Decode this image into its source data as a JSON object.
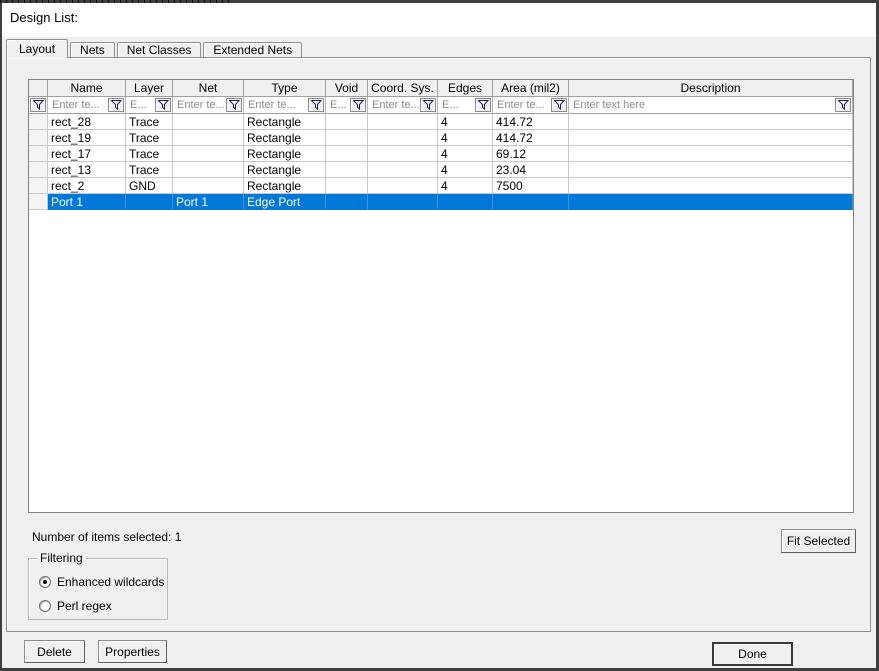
{
  "window": {
    "title": "Design List:"
  },
  "tabs": [
    {
      "label": "Layout",
      "active": true
    },
    {
      "label": "Nets",
      "active": false
    },
    {
      "label": "Net Classes",
      "active": false
    },
    {
      "label": "Extended Nets",
      "active": false
    }
  ],
  "table": {
    "columns": [
      {
        "key": "selector",
        "header": "",
        "placeholder": null
      },
      {
        "key": "name",
        "header": "Name",
        "placeholder": "Enter te..."
      },
      {
        "key": "layer",
        "header": "Layer",
        "placeholder": "E..."
      },
      {
        "key": "net",
        "header": "Net",
        "placeholder": "Enter te..."
      },
      {
        "key": "type",
        "header": "Type",
        "placeholder": "Enter te..."
      },
      {
        "key": "void",
        "header": "Void",
        "placeholder": "E..."
      },
      {
        "key": "coord_sys",
        "header": "Coord. Sys.",
        "placeholder": "Enter te..."
      },
      {
        "key": "edges",
        "header": "Edges",
        "placeholder": "E..."
      },
      {
        "key": "area",
        "header": "Area (mil2)",
        "placeholder": "Enter te..."
      },
      {
        "key": "description",
        "header": "Description",
        "placeholder": "Enter text here"
      }
    ],
    "rows": [
      {
        "name": "rect_28",
        "layer": "Trace",
        "net": "",
        "type": "Rectangle",
        "void": "",
        "coord_sys": "",
        "edges": "4",
        "area": "414.72",
        "description": "",
        "selected": false
      },
      {
        "name": "rect_19",
        "layer": "Trace",
        "net": "",
        "type": "Rectangle",
        "void": "",
        "coord_sys": "",
        "edges": "4",
        "area": "414.72",
        "description": "",
        "selected": false
      },
      {
        "name": "rect_17",
        "layer": "Trace",
        "net": "",
        "type": "Rectangle",
        "void": "",
        "coord_sys": "",
        "edges": "4",
        "area": "69.12",
        "description": "",
        "selected": false
      },
      {
        "name": "rect_13",
        "layer": "Trace",
        "net": "",
        "type": "Rectangle",
        "void": "",
        "coord_sys": "",
        "edges": "4",
        "area": "23.04",
        "description": "",
        "selected": false
      },
      {
        "name": "rect_2",
        "layer": "GND",
        "net": "",
        "type": "Rectangle",
        "void": "",
        "coord_sys": "",
        "edges": "4",
        "area": "7500",
        "description": "",
        "selected": false
      },
      {
        "name": "Port 1",
        "layer": "",
        "net": "Port 1",
        "type": "Edge Port",
        "void": "",
        "coord_sys": "",
        "edges": "",
        "area": "",
        "description": "",
        "selected": true
      }
    ]
  },
  "status": {
    "items_selected": "Number of items selected: 1"
  },
  "buttons": {
    "fit_selected": "Fit Selected",
    "delete": "Delete",
    "properties": "Properties",
    "done": "Done"
  },
  "filtering": {
    "legend": "Filtering",
    "options": [
      {
        "label": "Enhanced wildcards",
        "selected": true
      },
      {
        "label": "Perl regex",
        "selected": false
      }
    ]
  },
  "colors": {
    "selection_blue": "#0078d7"
  }
}
